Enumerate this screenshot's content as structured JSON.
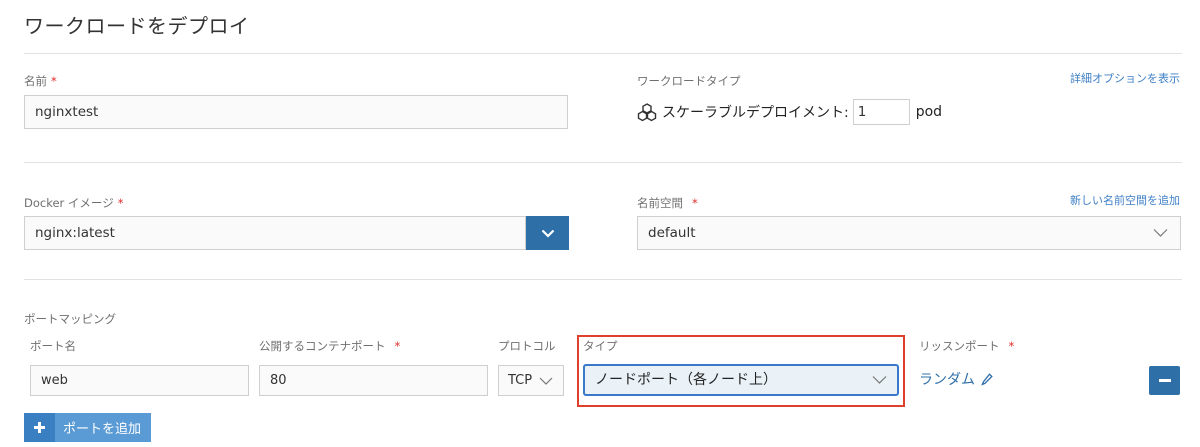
{
  "page": {
    "title": "ワークロードをデプロイ"
  },
  "name_field": {
    "label": "名前",
    "value": "nginxtest"
  },
  "workload_type": {
    "label": "ワークロードタイプ",
    "advanced_link": "詳細オプションを表示",
    "scalable_label": "スケーラブルデプロイメント:",
    "replicas": "1",
    "unit": "pod"
  },
  "docker_image": {
    "label": "Docker イメージ",
    "value": "nginx:latest"
  },
  "namespace": {
    "label": "名前空間",
    "add_link": "新しい名前空間を追加",
    "value": "default"
  },
  "port_mapping": {
    "section_label": "ポートマッピング",
    "headers": {
      "port_name": "ポート名",
      "container_port": "公開するコンテナポート",
      "protocol": "プロトコル",
      "type": "タイプ",
      "listen_port": "リッスンポート"
    },
    "row": {
      "port_name": "web",
      "container_port": "80",
      "protocol": "TCP",
      "type": "ノードポート（各ノード上）",
      "listen_port": "ランダム"
    },
    "add_button": "ポートを追加"
  },
  "colors": {
    "accent": "#2f6fa8",
    "highlight": "#e0402b",
    "required": "#e12b2b"
  }
}
